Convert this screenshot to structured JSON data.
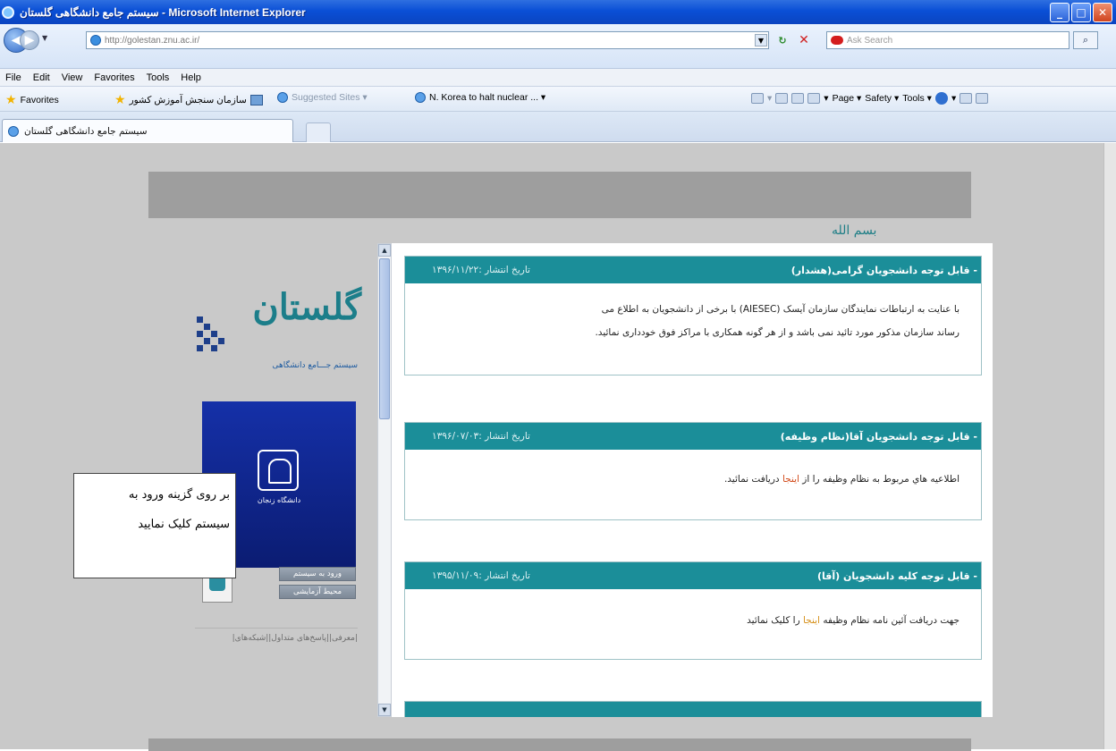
{
  "window": {
    "title": "سیستم جامع دانشگاهی گلستان - Microsoft Internet Explorer"
  },
  "address": {
    "url": "http://golestan.znu.ac.ir/",
    "search_placeholder": "Ask Search"
  },
  "menu": [
    "File",
    "Edit",
    "View",
    "Favorites",
    "Tools",
    "Help"
  ],
  "favorites": {
    "label": "Favorites",
    "item1": "سازمان سنجش آموزش کشور",
    "suggested": "Suggested Sites ▾",
    "news": "N. Korea to halt nuclear ... ▾",
    "page": "Page ▾",
    "safety": "Safety ▾",
    "tools": "Tools ▾"
  },
  "tab": {
    "title": "سیستم جامع دانشگاهی گلستان"
  },
  "page": {
    "basmala": "بسم الله",
    "logo_text": "گلستان",
    "logo_subtitle": "سیستم جـــامع دانشگاهی",
    "uni_label": "دانشگاه زنجان",
    "login_btn": "ورود به سیستم",
    "test_btn": "محیط آزمایشی",
    "bottom_links": "|معرفی||پاسخ‌های متداول||شبکه‌های|",
    "callout_line1": "بر روی گزینه ورود به",
    "callout_line2": "سیستم کلیک نمایید"
  },
  "news": [
    {
      "title": "- قابل توجه دانشجویان گرامی(هشدار)",
      "date": "تاریخ انتشار :۱۳۹۶/۱۱/۲۲",
      "body_1": "با عنایت به ارتباطات نمایندگان سازمان آیسک (AIESEC) با برخی از دانشجویان به اطلاع می",
      "body_2": "رساند سازمان مذکور مورد تائید نمی باشد و از هر گونه همکاری با مراکز فوق خودداری نمائید."
    },
    {
      "title": "- قابل توجه دانشجویان آقا(نظام وظیفه)",
      "date": "تاریخ انتشار :۱۳۹۶/۰۷/۰۳",
      "body_pre": "اطلاعیه هاي مربوط به نظام وظیفه را از ",
      "body_link": "اینجا",
      "body_post": " دریافت نمائید."
    },
    {
      "title": "- قابل توجه کلیه دانشجویان (آقا)",
      "date": "تاریخ انتشار :۱۳۹۵/۱۱/۰۹",
      "body_pre": "جهت دریافت آئین نامه نظام وظیفه ",
      "body_link": "اینجا",
      "body_post": " را کلیک نمائید"
    }
  ]
}
